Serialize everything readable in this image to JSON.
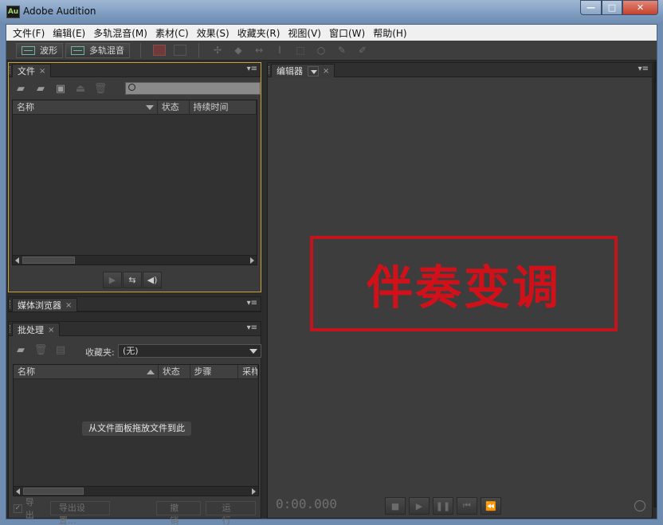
{
  "window": {
    "app_icon": "Au",
    "title": "Adobe Audition",
    "minimize": "—",
    "maximize": "□",
    "close": "✕"
  },
  "menu": {
    "items": [
      {
        "label": "文件(F)"
      },
      {
        "label": "编辑(E)"
      },
      {
        "label": "多轨混音(M)"
      },
      {
        "label": "素材(C)"
      },
      {
        "label": "效果(S)"
      },
      {
        "label": "收藏夹(R)"
      },
      {
        "label": "视图(V)"
      },
      {
        "label": "窗口(W)"
      },
      {
        "label": "帮助(H)"
      }
    ]
  },
  "toolbar": {
    "waveform_label": "波形",
    "multitrack_label": "多轨混音"
  },
  "files_panel": {
    "tab_label": "文件",
    "columns": [
      "名称",
      "状态",
      "持续时间"
    ]
  },
  "media_browser_panel": {
    "tab_label": "媒体浏览器"
  },
  "batch_panel": {
    "tab_label": "批处理",
    "favorites_label": "收藏夹:",
    "favorites_value": "(无)",
    "columns": [
      "名称",
      "状态",
      "步骤",
      "采样"
    ],
    "drop_hint": "从文件面板拖放文件到此",
    "export_label": "导出",
    "export_settings_label": "导出设置...",
    "undo_label": "撤销",
    "run_label": "运行"
  },
  "editor_panel": {
    "tab_label": "编辑器",
    "stamp_text": "伴奏变调",
    "stamp_color": "#d1111a",
    "timecode": "0:00.000"
  },
  "colors": {
    "panel_bg": "#3b3b3b",
    "active_border": "#c8a23c",
    "accent_teal": "#6bb7a4"
  }
}
